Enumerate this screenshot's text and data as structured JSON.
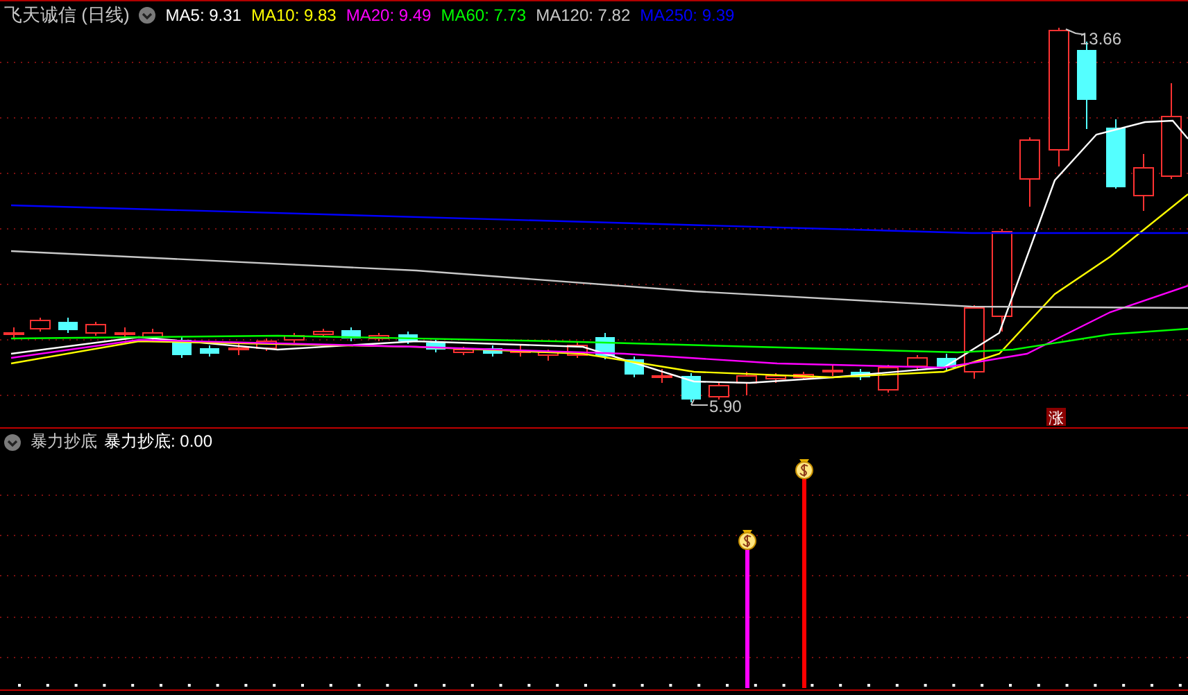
{
  "title": "飞天诚信 (日线)",
  "ma_legend": [
    {
      "label": "MA5: 9.31",
      "color": "#ffffff"
    },
    {
      "label": "MA10: 9.83",
      "color": "#ffff00"
    },
    {
      "label": "MA20: 9.49",
      "color": "#ff00ff"
    },
    {
      "label": "MA60: 7.73",
      "color": "#00ff00"
    },
    {
      "label": "MA120: 7.82",
      "color": "#c8c8c8"
    },
    {
      "label": "MA250: 9.39",
      "color": "#0000ff"
    }
  ],
  "price_marks": {
    "high": "13.66",
    "low": "5.90"
  },
  "badge": "涨",
  "indicator": {
    "name": "暴力抄底",
    "value_label": "暴力抄底: 0.00"
  }
}
